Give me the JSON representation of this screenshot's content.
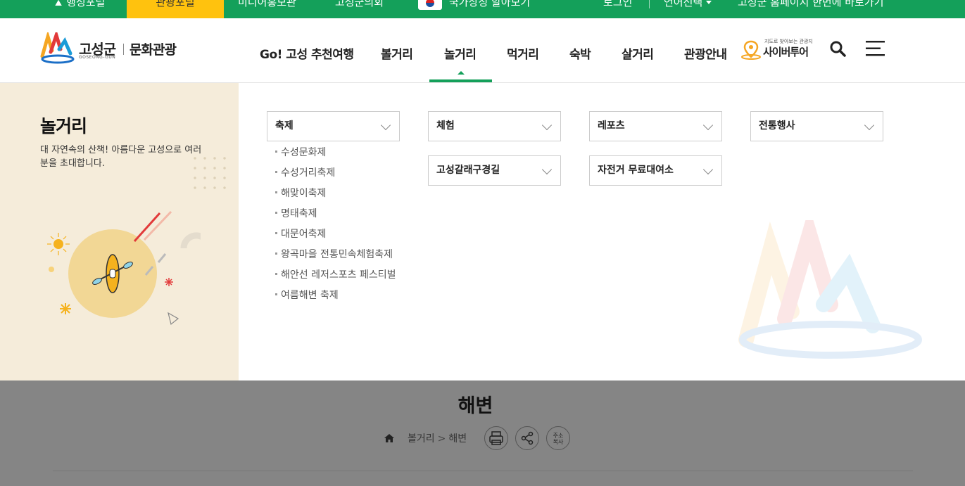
{
  "topbar": {
    "items": [
      {
        "label": "행정포털",
        "active": false
      },
      {
        "label": "관광포털",
        "active": true
      },
      {
        "label": "미디어홍보관",
        "active": false
      },
      {
        "label": "고성군의회",
        "active": false
      },
      {
        "label": "국가상징 알아보기",
        "active": false
      }
    ],
    "login": "로그인",
    "language": "언어선택",
    "homepage": "고성군 홈페이지 한번에 바로가기"
  },
  "header": {
    "logo_name": "고성군",
    "logo_sub": "GOSEONG-GUN",
    "logo_section": "문화관광",
    "menu": [
      {
        "label": "Go! 고성 추천여행"
      },
      {
        "label": "볼거리"
      },
      {
        "label": "놀거리",
        "active": true
      },
      {
        "label": "먹거리"
      },
      {
        "label": "숙박"
      },
      {
        "label": "살거리"
      },
      {
        "label": "관광안내"
      }
    ],
    "cyber_small": "지도로 찾아보는 관광지",
    "cyber_big": "사이버투어"
  },
  "mega": {
    "title": "놀거리",
    "description": "대 자연속의 산책! 아름다운 고성으로 여러분을 초대합니다.",
    "dropdowns": [
      {
        "label": "축제"
      },
      {
        "label": "체험"
      },
      {
        "label": "레포츠"
      },
      {
        "label": "전통행사"
      },
      {
        "label": "고성갈래구경길"
      },
      {
        "label": "자전거 무료대여소"
      }
    ],
    "festival_items": [
      "수성문화제",
      "수성거리축제",
      "해맞이축제",
      "명태축제",
      "대문어축제",
      "왕곡마을 전통민속체험축제",
      "해안선 레저스포츠 페스티벌",
      "여름해변 축제"
    ]
  },
  "page": {
    "title": "해변",
    "breadcrumb": [
      "볼거리",
      "해변"
    ],
    "copy_address": "주소\n복사"
  },
  "colors": {
    "primary": "#14a05a",
    "accent": "#ffc20e",
    "panel_bg": "#f5ecda"
  }
}
